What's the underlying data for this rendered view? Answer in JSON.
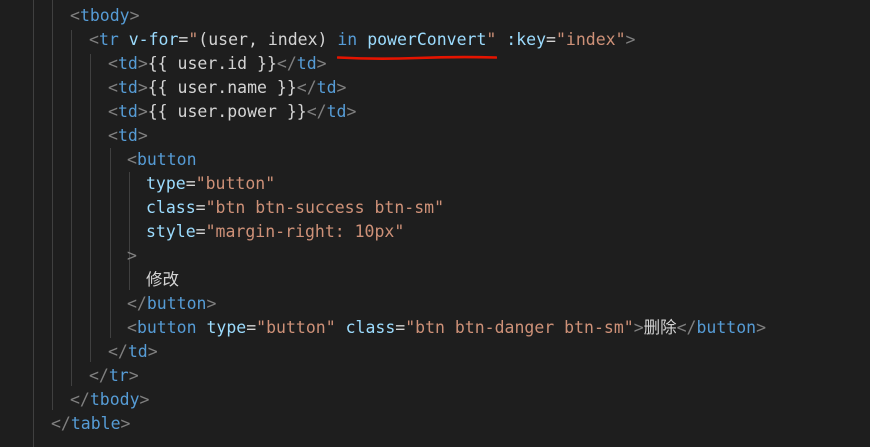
{
  "code": {
    "line1": {
      "open": "<",
      "tag": "tbody",
      "close": ">"
    },
    "line2": {
      "open": "<",
      "tag": "tr",
      "attr1": "v-for",
      "eq1": "=",
      "q1": "\"",
      "v_user": "(user, index)",
      "v_in": "in",
      "v_conv": "powerConvert",
      "q2": "\"",
      "attr2": ":key",
      "eq2": "=",
      "str2": "\"index\"",
      "close": ">"
    },
    "line3": {
      "open": "<",
      "tag": "td",
      "close": ">",
      "text": "{{ user.id }}",
      "end_open": "</",
      "end_tag": "td",
      "end_close": ">"
    },
    "line4": {
      "open": "<",
      "tag": "td",
      "close": ">",
      "text": "{{ user.name }}",
      "end_open": "</",
      "end_tag": "td",
      "end_close": ">"
    },
    "line5": {
      "open": "<",
      "tag": "td",
      "close": ">",
      "text": "{{ user.power }}",
      "end_open": "</",
      "end_tag": "td",
      "end_close": ">"
    },
    "line6": {
      "open": "<",
      "tag": "td",
      "close": ">"
    },
    "line7": {
      "open": "<",
      "tag": "button"
    },
    "line8": {
      "attr": "type",
      "eq": "=",
      "str": "\"button\""
    },
    "line9": {
      "attr": "class",
      "eq": "=",
      "str": "\"btn btn-success btn-sm\""
    },
    "line10": {
      "attr": "style",
      "eq": "=",
      "str": "\"margin-right: 10px\""
    },
    "line11": {
      "close": ">"
    },
    "line12": {
      "text": "修改"
    },
    "line13": {
      "end_open": "</",
      "end_tag": "button",
      "end_close": ">"
    },
    "line14": {
      "open": "<",
      "tag": "button",
      "attr1": "type",
      "eq1": "=",
      "str1": "\"button\"",
      "attr2": "class",
      "eq2": "=",
      "str2": "\"btn btn-danger btn-sm\"",
      "close": ">",
      "text": "删除",
      "end_open": "</",
      "end_tag": "button",
      "end_close": ">"
    },
    "line15": {
      "end_open": "</",
      "end_tag": "td",
      "end_close": ">"
    },
    "line16": {
      "end_open": "</",
      "end_tag": "tr",
      "end_close": ">"
    },
    "line17": {
      "end_open": "</",
      "end_tag": "tbody",
      "end_close": ">"
    },
    "line18": {
      "end_open": "</",
      "end_tag": "table",
      "end_close": ">"
    }
  },
  "colors": {
    "background": "#1e1e1e",
    "tag": "#569cd6",
    "punctuation": "#808080",
    "attribute": "#9cdcfe",
    "string": "#ce9178",
    "text": "#d4d4d4",
    "underline": "#e51400"
  }
}
